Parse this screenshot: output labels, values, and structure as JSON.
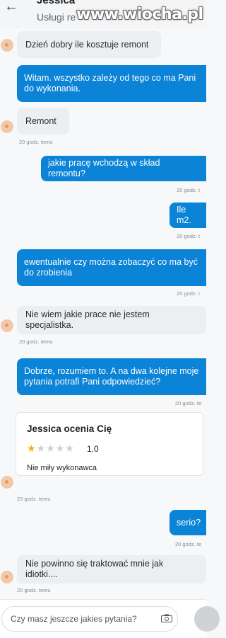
{
  "header": {
    "contact_name": "Jessica",
    "subtitle": "Usługi re",
    "watermark": "www.wiocha.pl"
  },
  "messages": [
    {
      "text": "Dzień dobry ile kosztuje remont"
    },
    {
      "text": "Witam. wszystko zależy od tego co ma Pani do wykonania."
    },
    {
      "text": "Remont",
      "time": "20 godz. temu"
    },
    {
      "text": "jakie pracę wchodzą w skład remontu?",
      "time": "20 godz. t"
    },
    {
      "text": "Ile m2.",
      "time": "20 godz. t"
    },
    {
      "text": "ewentualnie czy można zobaczyć co ma być do zrobienia",
      "time": "20 godz. t"
    },
    {
      "text": "Nie wiem jakie prace nie jestem specjalistka.",
      "time": "20 godz. temu"
    },
    {
      "text": "Dobrze, rozumiem to. A na dwa kolejne moje pytania potrafi Pani odpowiedzieć?",
      "time": "20 godz. te"
    },
    {
      "text": "serio?",
      "time": "20 godz. te"
    },
    {
      "text": "Nie powinno się traktować mnie jak idiotki....",
      "time": "20 godz. temu"
    }
  ],
  "review": {
    "title": "Jessica  ocenia Cię",
    "rating": 1.0,
    "rating_label": "1.0",
    "max_stars": 5,
    "text": "Nie miły wykonawca",
    "time": "20 godz. temu"
  },
  "composer": {
    "placeholder": "Czy masz jeszcze jakies pytania?"
  },
  "colors": {
    "outgoing_bubble": "#0b83d6",
    "incoming_bubble": "#eceef2",
    "star": "#f5b400"
  }
}
